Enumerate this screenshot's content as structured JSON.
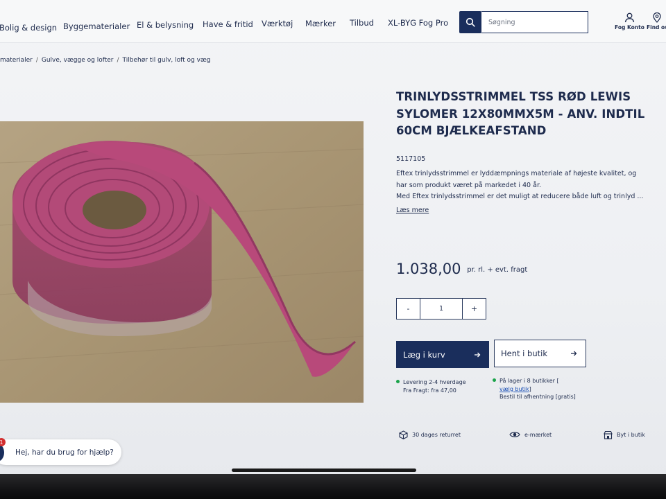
{
  "nav": {
    "items": [
      {
        "label": "Bolig & design"
      },
      {
        "label": "Byggematerialer"
      },
      {
        "label": "El & belysning"
      },
      {
        "label": "Have & fritid"
      },
      {
        "label": "Værktøj"
      },
      {
        "label": "Mærker"
      },
      {
        "label": "Tilbud"
      },
      {
        "label": "XL-BYG Fog Pro"
      }
    ],
    "search_placeholder": "Søgning",
    "account_label": "Fog Konto",
    "find_label": "Find os"
  },
  "breadcrumb": [
    "materialer",
    "Gulve, vægge og lofter",
    "Tilbehør til gulv, loft og væg"
  ],
  "product": {
    "title": "TRINLYDSSTRIMMEL TSS RØD LEWIS SYLOMER 12X80MMX5M - ANV. INDTIL 60CM BJÆLKEAFSTAND",
    "sku": "5117105",
    "desc_line1": "Eftex trinlydsstrimmel er lyddæmpnings materiale af højeste kvalitet, og",
    "desc_line2": "har som produkt været på markedet i 40 år.",
    "desc_line3": "Med Eftex trinlydsstrimmel er det muligt at reducere både luft og trinlyd ...",
    "read_more": "Læs mere",
    "price": "1.038,00",
    "price_note": "pr. rl. + evt. fragt",
    "quantity": "1",
    "qty_minus": "-",
    "qty_plus": "+",
    "add_to_cart": "Læg i kurv",
    "pickup": "Hent i butik",
    "delivery_line1": "Levering 2-4 hverdage",
    "delivery_line2": "Fra Fragt: fra 47,00",
    "stock_line1": "På lager i 8 butikker [",
    "stock_link": "vælg butik",
    "stock_link_close": "]",
    "stock_line3": "Bestil til afhentning [gratis]"
  },
  "usps": [
    {
      "label": "30 dages returret",
      "icon": "box-icon"
    },
    {
      "label": "e-mærket",
      "icon": "eye-icon"
    },
    {
      "label": "Byt i butik",
      "icon": "store-icon"
    }
  ],
  "chat": {
    "label": "Hej, har du brug for hjælp?",
    "badge": "1"
  },
  "colors": {
    "brand_navy": "#1a2e5c",
    "stock_green": "#1aa34a",
    "product_pink": "#b34a78"
  }
}
